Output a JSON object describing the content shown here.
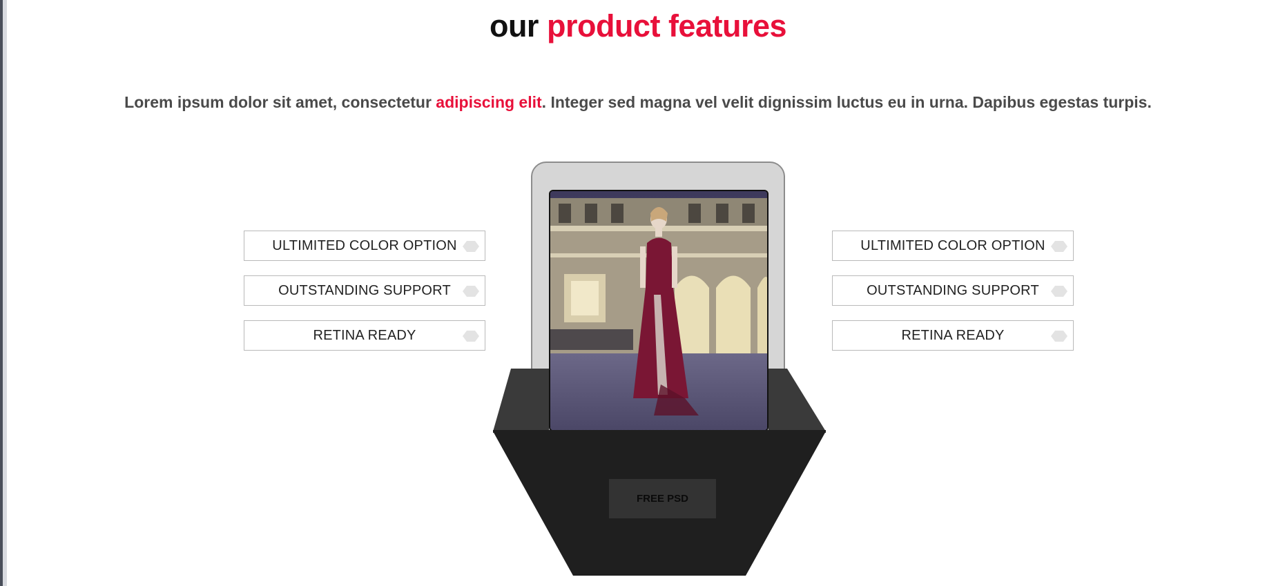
{
  "header": {
    "title_plain": "our",
    "title_accent": "product features"
  },
  "intro": {
    "before": "Lorem ipsum dolor sit amet, consectetur ",
    "accent": "adipiscing elit",
    "after": ". Integer sed magna vel velit dignissim luctus eu in urna. Dapibus egestas turpis."
  },
  "features_left": [
    {
      "label": "ULTIMITED COLOR OPTION"
    },
    {
      "label": "OUTSTANDING SUPPORT"
    },
    {
      "label": "RETINA READY"
    }
  ],
  "features_right": [
    {
      "label": "ULTIMITED COLOR OPTION"
    },
    {
      "label": "OUTSTANDING SUPPORT"
    },
    {
      "label": "RETINA READY"
    }
  ],
  "device": {
    "cta_label": "FREE PSD"
  },
  "colors": {
    "accent": "#e8103a",
    "text": "#4a4a4a",
    "holder": "#1f1f1f"
  }
}
